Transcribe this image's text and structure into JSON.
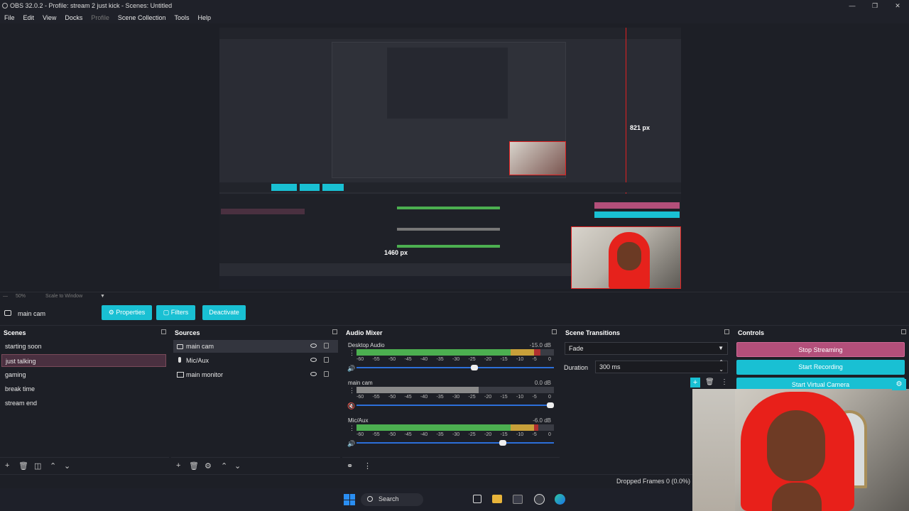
{
  "window": {
    "title": "OBS 32.0.2 - Profile: stream 2 just kick - Scenes: Untitled",
    "controls": [
      "—",
      "❐",
      "✕"
    ]
  },
  "menu": {
    "items": [
      "File",
      "Edit",
      "View",
      "Docks",
      "Profile",
      "Scene Collection",
      "Tools",
      "Help"
    ]
  },
  "preview": {
    "annotations": {
      "height_label": "821 px",
      "width_label": "1460 px"
    },
    "scale_percent": "50%",
    "scale_mode": "Scale to Window"
  },
  "source_toolbar": {
    "selected_source": "main cam",
    "properties_label": "Properties",
    "filters_label": "Filters",
    "deactivate_label": "Deactivate"
  },
  "scenes": {
    "title": "Scenes",
    "items": [
      "starting soon",
      "just talking",
      "gaming",
      "break time",
      "stream end"
    ],
    "selected": "just talking"
  },
  "sources": {
    "title": "Sources",
    "items": [
      {
        "label": "main cam",
        "icon": "camera-icon"
      },
      {
        "label": "Mic/Aux",
        "icon": "microphone-icon"
      },
      {
        "label": "main monitor",
        "icon": "monitor-icon"
      }
    ]
  },
  "mixer": {
    "title": "Audio Mixer",
    "channels": [
      {
        "name": "Desktop Audio",
        "db": "-15.0 dB",
        "level": 0.93,
        "volume": 0.6
      },
      {
        "name": "main cam",
        "db": "0.0 dB",
        "level": 0.62,
        "volume": 1.0
      },
      {
        "name": "Mic/Aux",
        "db": "-6.0 dB",
        "level": 0.92,
        "volume": 0.75
      }
    ],
    "ticks": [
      "-60",
      "-55",
      "-50",
      "-45",
      "-40",
      "-35",
      "-30",
      "-25",
      "-20",
      "-15",
      "-10",
      "-5",
      "0"
    ]
  },
  "transitions": {
    "title": "Scene Transitions",
    "selected": "Fade",
    "duration_label": "Duration",
    "duration_value": "300 ms"
  },
  "controls": {
    "title": "Controls",
    "stop_streaming": "Stop Streaming",
    "start_recording": "Start Recording",
    "start_virtual_camera": "Start Virtual Camera"
  },
  "status": {
    "dropped_frames": "Dropped Frames 0 (0.0%)"
  },
  "taskbar": {
    "search_label": "Search"
  },
  "colors": {
    "accent": "#19c0d3",
    "stop_streaming": "#b34f7a",
    "selection": "#4a3040",
    "meter_green": "#4caf50",
    "meter_yellow": "#c8a03a",
    "meter_red": "#b03030",
    "slider_blue": "#2c6fd9"
  }
}
